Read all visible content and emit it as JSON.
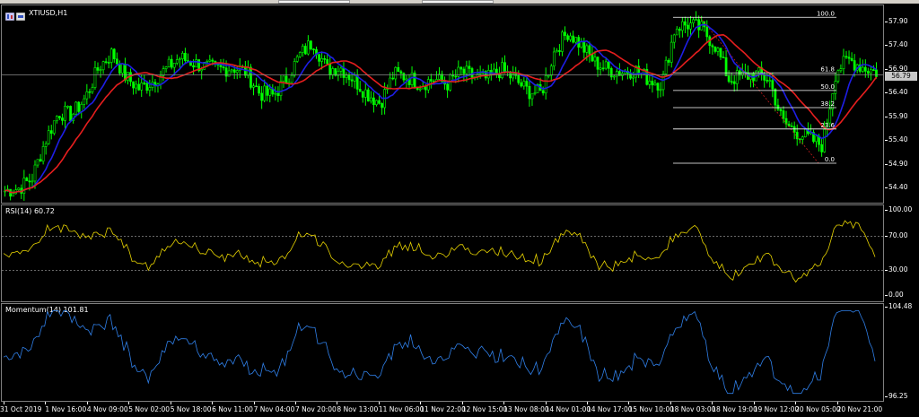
{
  "window": {
    "symbol_title": "XTIUSD,H1"
  },
  "colors": {
    "background": "#000000",
    "candle_up": "#00ff00",
    "candle_down": "#00ff00",
    "ma_fast": "#1e1ee6",
    "ma_slow": "#e61e1e",
    "rsi_line": "#e6d200",
    "momentum_line": "#2f7fe8",
    "fib_line": "#ffffff",
    "fib_trend": "#c81e1e",
    "grid_level": "#8a8a8a"
  },
  "price_axis": {
    "labels": [
      "57.90",
      "57.40",
      "56.90",
      "56.40",
      "55.90",
      "55.40",
      "54.90",
      "54.40"
    ],
    "current_price": "56.79"
  },
  "fibonacci": {
    "levels": [
      {
        "label": "100.0",
        "price": 58.0
      },
      {
        "label": "61.8",
        "price": 56.83
      },
      {
        "label": "50.0",
        "price": 56.46
      },
      {
        "label": "38.2",
        "price": 56.1
      },
      {
        "label": "23.6",
        "price": 55.65
      },
      {
        "label": "0.0",
        "price": 54.93
      }
    ]
  },
  "rsi": {
    "label": "RSI(14) 60.72",
    "scale": [
      "100.00",
      "70.00",
      "30.00",
      "0.00"
    ]
  },
  "momentum": {
    "label": "Momentum(14) 101.81",
    "scale": [
      "104.48",
      "96.25"
    ]
  },
  "time_axis": {
    "labels": [
      "31 Oct 2019",
      "1 Nov 16:00",
      "4 Nov 09:00",
      "5 Nov 02:00",
      "5 Nov 18:00",
      "6 Nov 11:00",
      "7 Nov 04:00",
      "7 Nov 20:00",
      "8 Nov 13:00",
      "11 Nov 06:00",
      "11 Nov 22:00",
      "12 Nov 15:00",
      "13 Nov 08:00",
      "14 Nov 01:00",
      "14 Nov 17:00",
      "15 Nov 10:00",
      "18 Nov 03:00",
      "18 Nov 19:00",
      "19 Nov 12:00",
      "20 Nov 05:00",
      "20 Nov 21:00"
    ]
  },
  "chart_data": {
    "type": "line",
    "title": "XTIUSD,H1",
    "series": [
      {
        "name": "XTIUSD",
        "values": [
          54.35,
          54.4,
          54.6,
          55.4,
          56.0,
          55.95,
          56.3,
          56.95,
          57.25,
          56.75,
          56.5,
          56.65,
          56.9,
          57.15,
          57.05,
          56.95,
          56.9,
          56.95,
          56.85,
          56.4,
          56.35,
          56.7,
          57.2,
          57.5,
          56.9,
          56.95,
          56.7,
          56.4,
          56.2,
          56.8,
          56.75,
          56.6,
          56.7,
          56.6,
          56.85,
          56.75,
          56.7,
          56.9,
          56.7,
          56.45,
          56.4,
          57.3,
          57.7,
          57.4,
          57.05,
          56.9,
          56.85,
          56.9,
          56.7,
          56.6,
          57.8,
          57.85,
          57.75,
          57.4,
          56.7,
          56.75,
          56.8,
          56.7,
          55.8,
          55.6,
          55.45,
          55.3,
          56.9,
          57.1,
          56.95,
          56.85
        ]
      }
    ],
    "ylim": [
      54.1,
      58.25
    ]
  }
}
